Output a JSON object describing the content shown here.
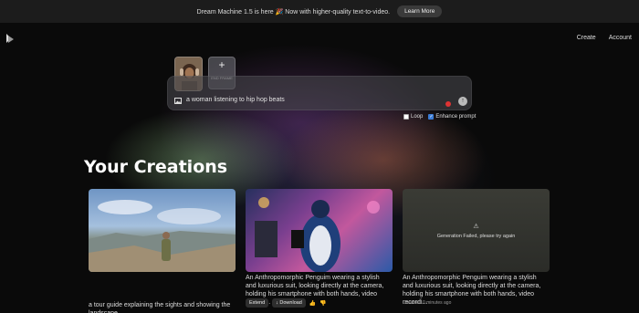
{
  "banner": {
    "text": "Dream Machine 1.5 is here 🎉 Now with higher-quality text-to-video.",
    "button": "Learn More"
  },
  "nav": {
    "create": "Create",
    "account": "Account"
  },
  "prompt": {
    "end_frame_label": "END FRAME",
    "text": "a woman listening to hip hop beats"
  },
  "options": {
    "loop": "Loop",
    "enhance": "Enhance prompt"
  },
  "section_title": "Your Creations",
  "creations": [
    {
      "description": "a tour guide explaining the sights and showing the landscape"
    },
    {
      "description": "An Anthropomorphic Penguim wearing a stylish and luxurious suit, looking directly at the camera, holding his smartphone with both hands, video recordi...",
      "extend": "Extend",
      "download": "Download"
    },
    {
      "failed": "Generation Failed, please try again",
      "description": "An Anthropomorphic Penguim wearing a stylish and luxurious suit, looking directly at the camera, holding his smartphone with both hands, video recordi...",
      "created": "Created 10 minutes ago"
    }
  ]
}
